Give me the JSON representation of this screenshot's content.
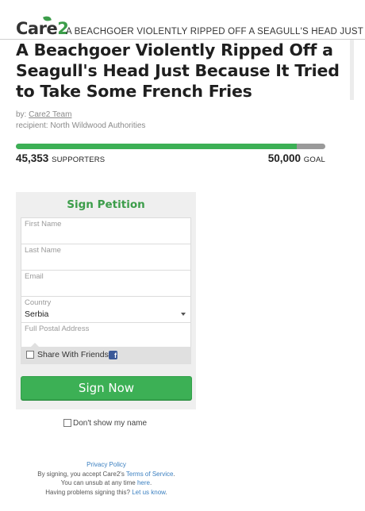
{
  "header": {
    "logo_prefix": "Care",
    "logo_suffix": "2",
    "scrolling_title": "A BEACHGOER VIOLENTLY RIPPED OFF A SEAGULL'S HEAD JUST BECAUSE IT TRIED TO TAKE SOME FRENCH FRIES"
  },
  "petition": {
    "title": "A Beachgoer Violently Ripped Off a Seagull's Head Just Because It Tried to Take Some French Fries",
    "by_prefix": "by:",
    "author": "Care2 Team",
    "recipient": "recipient: North Wildwood Authorities"
  },
  "progress": {
    "supporters_count": "45,353",
    "supporters_label": "SUPPORTERS",
    "goal_count": "50,000",
    "goal_label": "GOAL",
    "fraction": 0.907,
    "fill_color": "#3cb055",
    "track_color": "#9a9a9a"
  },
  "form": {
    "heading": "Sign Petition",
    "first_name_label": "First Name",
    "last_name_label": "Last Name",
    "email_label": "Email",
    "country_label": "Country",
    "country_value": "Serbia",
    "postal_label": "Full Postal Address",
    "share_label": "Share With Friends",
    "share_icon": "facebook-icon",
    "submit_label": "Sign Now",
    "anonymous_label": "Don't show my name"
  },
  "footer": {
    "privacy": "Privacy Policy",
    "terms_prefix": "By signing, you accept Care2's ",
    "terms_link": "Terms of Service",
    "terms_suffix": ".",
    "unsub_prefix": "You can unsub at any time ",
    "unsub_link": "here",
    "unsub_suffix": ".",
    "help_prefix": "Having problems signing this? ",
    "help_link": "Let us know",
    "help_suffix": "."
  },
  "colors": {
    "accent_green": "#3c9d4a",
    "button_green": "#3cb055",
    "link_blue": "#3a7fc0"
  }
}
